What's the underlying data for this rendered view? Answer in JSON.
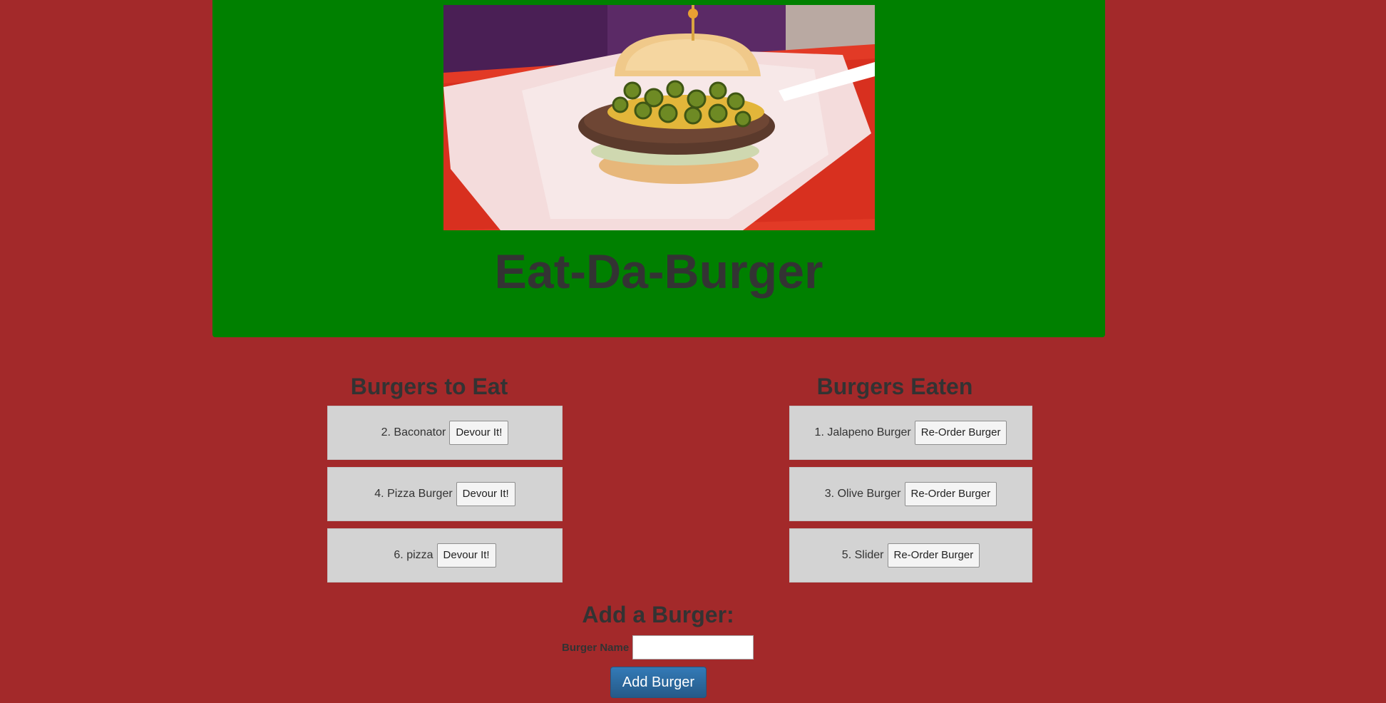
{
  "header": {
    "title": "Eat-Da-Burger",
    "photo_subject": "burger-photo"
  },
  "burgers_to_eat": {
    "heading": "Burgers to Eat",
    "items": [
      {
        "label": "2. Baconator",
        "button": "Devour It!"
      },
      {
        "label": "4. Pizza Burger",
        "button": "Devour It!"
      },
      {
        "label": "6. pizza",
        "button": "Devour It!"
      }
    ]
  },
  "burgers_eaten": {
    "heading": "Burgers Eaten",
    "items": [
      {
        "label": "1. Jalapeno Burger",
        "button": "Re-Order Burger"
      },
      {
        "label": "3. Olive Burger",
        "button": "Re-Order Burger"
      },
      {
        "label": "5. Slider",
        "button": "Re-Order Burger"
      }
    ]
  },
  "add_form": {
    "heading": "Add a Burger:",
    "field_label": "Burger Name",
    "field_value": "",
    "submit_label": "Add Burger"
  },
  "colors": {
    "page_background": "#a3292a",
    "jumbotron": "#008000",
    "well": "#d3d3d3",
    "text": "#333333",
    "primary_button": "#337ab7"
  }
}
